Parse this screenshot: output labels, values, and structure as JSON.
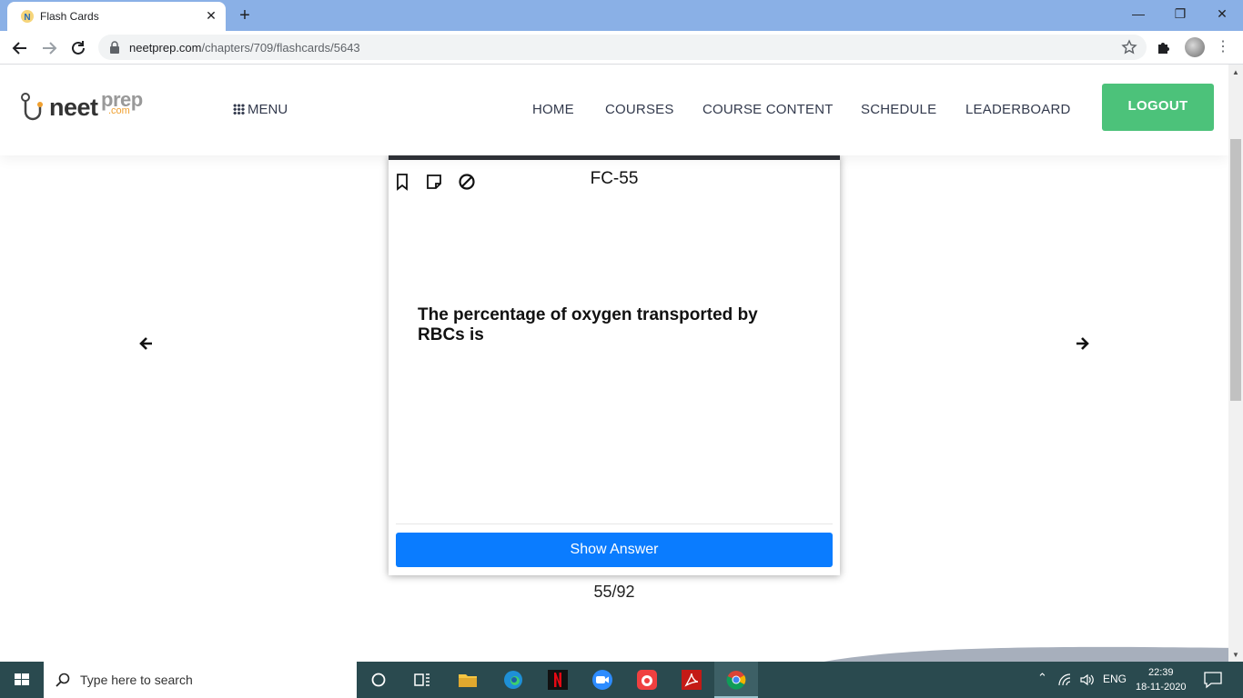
{
  "browser": {
    "tab_title": "Flash Cards",
    "url_host": "neetprep.com",
    "url_path": "/chapters/709/flashcards/5643"
  },
  "site": {
    "logo": {
      "neet": "neet",
      "prep": "prep",
      "com": ".com"
    },
    "menu_label": "MENU",
    "nav": [
      "HOME",
      "COURSES",
      "COURSE CONTENT",
      "SCHEDULE",
      "LEADERBOARD"
    ],
    "logout_label": "LOGOUT"
  },
  "flashcard": {
    "id_label": "FC-55",
    "question": "The percentage of oxygen transported by RBCs is",
    "show_answer_label": "Show Answer",
    "counter": "55/92"
  },
  "taskbar": {
    "search_placeholder": "Type here to search",
    "language": "ENG",
    "time": "22:39",
    "date": "18-11-2020"
  },
  "colors": {
    "logout": "#4cc27a",
    "show_answer": "#0a7cff",
    "tabbar": "#8ab0e6",
    "taskbar": "#2a4a4f"
  }
}
